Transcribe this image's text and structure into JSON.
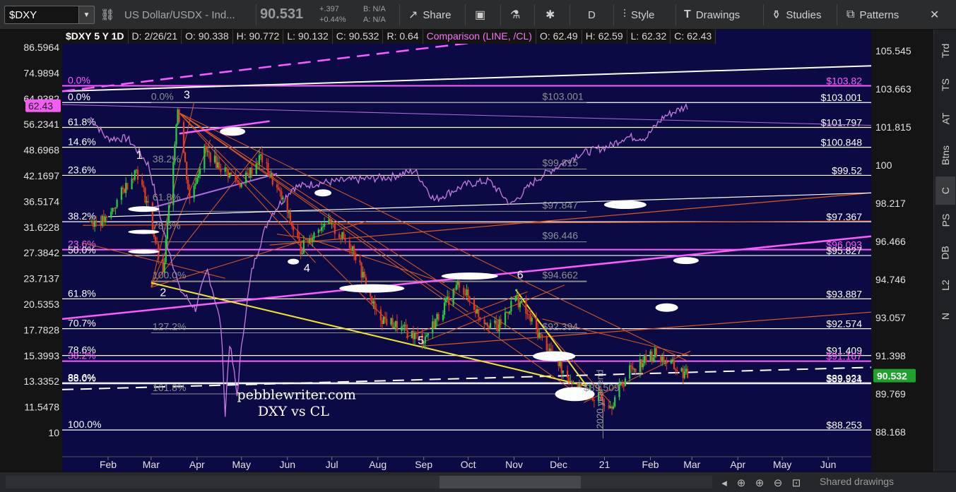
{
  "toolbar": {
    "symbol": "$DXY",
    "description": "US Dollar/USDX - Ind...",
    "price": "90.531",
    "change_abs": "+.397",
    "change_pct": "+0.44%",
    "bid": "B: N/A",
    "ask": "A: N/A",
    "share_label": "Share",
    "period_label": "D",
    "style_label": "Style",
    "drawings_label": "Drawings",
    "studies_label": "Studies",
    "patterns_label": "Patterns"
  },
  "header": {
    "symbol_period": "$DXY 5 Y 1D",
    "date": "D: 2/26/21",
    "open": "O: 90.338",
    "high": "H: 90.772",
    "low": "L: 90.132",
    "close": "C: 90.532",
    "range": "R: 0.64",
    "comparison": "Comparison (LINE, /CL)",
    "cmp_open": "O: 62.49",
    "cmp_high": "H: 62.59",
    "cmp_low": "L: 62.32",
    "cmp_close": "C: 62.43"
  },
  "side_tabs": [
    "Trd",
    "TS",
    "AT",
    "Btns",
    "C",
    "PS",
    "DB",
    "L2",
    "N"
  ],
  "bottom": {
    "shared_label": "Shared drawings"
  },
  "colors": {
    "plot_bg": "#0c0a45",
    "price_up": "#2ecc40",
    "price_down": "#e8391d",
    "comparison": "#c77be0",
    "fib_magenta": "#ff5cff",
    "trend_yellow": "#f1e22c",
    "fan_orange": "#e05a1c",
    "last_price_badge": "#1fa12d",
    "cmp_badge": "#f25cf2"
  },
  "chart_data": {
    "type": "candlestick",
    "x_axis_labels": [
      "Feb",
      "Mar",
      "Apr",
      "May",
      "Jun",
      "Jul",
      "Aug",
      "Sep",
      "Oct",
      "Nov",
      "Dec",
      "21",
      "Feb",
      "Mar",
      "Apr",
      "May",
      "Jun"
    ],
    "right_axis": {
      "ticks": [
        "105.545",
        "103.663",
        "101.815",
        "100",
        "98.217",
        "96.466",
        "94.746",
        "93.057",
        "91.398",
        "89.769",
        "88.168"
      ],
      "scale": "log",
      "range": [
        87.6,
        106.2
      ]
    },
    "left_axis": {
      "ticks": [
        "86.5964",
        "74.9894",
        "64.9382",
        "56.2341",
        "48.6968",
        "42.1697",
        "36.5174",
        "31.6228",
        "27.3842",
        "23.7137",
        "20.5353",
        "17.7828",
        "15.3993",
        "13.3352",
        "11.5478",
        "10"
      ],
      "scale": "log"
    },
    "last_price": "90.532",
    "comparison_last": "62.43",
    "price_series": [
      {
        "d": "2020-01-20",
        "v": 97.4
      },
      {
        "d": "2020-01-31",
        "v": 97.4
      },
      {
        "d": "2020-02-10",
        "v": 98.7
      },
      {
        "d": "2020-02-20",
        "v": 99.8
      },
      {
        "d": "2020-02-28",
        "v": 98.1
      },
      {
        "d": "2020-03-09",
        "v": 94.8
      },
      {
        "d": "2020-03-19",
        "v": 102.8
      },
      {
        "d": "2020-03-27",
        "v": 98.4
      },
      {
        "d": "2020-04-06",
        "v": 100.7
      },
      {
        "d": "2020-04-17",
        "v": 99.9
      },
      {
        "d": "2020-05-01",
        "v": 99.1
      },
      {
        "d": "2020-05-14",
        "v": 100.4
      },
      {
        "d": "2020-05-29",
        "v": 98.3
      },
      {
        "d": "2020-06-10",
        "v": 96.1
      },
      {
        "d": "2020-06-26",
        "v": 97.4
      },
      {
        "d": "2020-07-15",
        "v": 96.2
      },
      {
        "d": "2020-07-31",
        "v": 93.2
      },
      {
        "d": "2020-08-18",
        "v": 92.5
      },
      {
        "d": "2020-09-01",
        "v": 92.1
      },
      {
        "d": "2020-09-25",
        "v": 94.6
      },
      {
        "d": "2020-10-09",
        "v": 93.1
      },
      {
        "d": "2020-10-21",
        "v": 92.6
      },
      {
        "d": "2020-11-02",
        "v": 94.0
      },
      {
        "d": "2020-11-18",
        "v": 92.3
      },
      {
        "d": "2020-12-04",
        "v": 90.8
      },
      {
        "d": "2020-12-17",
        "v": 89.8
      },
      {
        "d": "2021-01-06",
        "v": 89.4
      },
      {
        "d": "2021-01-18",
        "v": 90.8
      },
      {
        "d": "2021-02-04",
        "v": 91.5
      },
      {
        "d": "2021-02-17",
        "v": 90.9
      },
      {
        "d": "2021-02-26",
        "v": 90.53
      }
    ],
    "comparison_series": [
      {
        "d": "2020-01-20",
        "v": 58.5
      },
      {
        "d": "2020-01-31",
        "v": 52.0
      },
      {
        "d": "2020-02-14",
        "v": 52.0
      },
      {
        "d": "2020-02-28",
        "v": 45.0
      },
      {
        "d": "2020-03-09",
        "v": 31.1
      },
      {
        "d": "2020-03-20",
        "v": 22.4
      },
      {
        "d": "2020-03-31",
        "v": 20.0
      },
      {
        "d": "2020-04-08",
        "v": 24.8
      },
      {
        "d": "2020-04-17",
        "v": 18.3
      },
      {
        "d": "2020-04-20",
        "v": 11.0
      },
      {
        "d": "2020-04-23",
        "v": 16.5
      },
      {
        "d": "2020-04-28",
        "v": 12.3
      },
      {
        "d": "2020-05-08",
        "v": 24.7
      },
      {
        "d": "2020-05-20",
        "v": 33.5
      },
      {
        "d": "2020-06-05",
        "v": 39.5
      },
      {
        "d": "2020-06-22",
        "v": 40.5
      },
      {
        "d": "2020-07-15",
        "v": 41.2
      },
      {
        "d": "2020-08-10",
        "v": 41.9
      },
      {
        "d": "2020-08-26",
        "v": 43.4
      },
      {
        "d": "2020-09-08",
        "v": 36.8
      },
      {
        "d": "2020-09-30",
        "v": 40.2
      },
      {
        "d": "2020-10-15",
        "v": 41.0
      },
      {
        "d": "2020-10-30",
        "v": 35.8
      },
      {
        "d": "2020-11-16",
        "v": 41.3
      },
      {
        "d": "2020-12-01",
        "v": 44.6
      },
      {
        "d": "2020-12-15",
        "v": 47.6
      },
      {
        "d": "2021-01-05",
        "v": 49.9
      },
      {
        "d": "2021-01-15",
        "v": 52.4
      },
      {
        "d": "2021-01-29",
        "v": 52.2
      },
      {
        "d": "2021-02-10",
        "v": 58.7
      },
      {
        "d": "2021-02-26",
        "v": 62.4
      }
    ],
    "price_levels": [
      {
        "value": 103.82,
        "label": "$103.82",
        "color": "#ff5cff",
        "dashed": false
      },
      {
        "value": 103.001,
        "label": "$103.001",
        "color": "#ffffff",
        "dashed": false
      },
      {
        "value": 101.797,
        "label": "$101.797",
        "color": "#ffffff",
        "dashed": false
      },
      {
        "value": 100.848,
        "label": "$100.848",
        "color": "#ffffff",
        "dashed": false
      },
      {
        "value": 99.52,
        "label": "$99.52",
        "color": "#ffffff",
        "dashed": false
      },
      {
        "value": 97.367,
        "label": "$97.367",
        "color": "#ffffff",
        "dashed": false
      },
      {
        "value": 96.093,
        "label": "$96.093",
        "color": "#ff5cff",
        "dashed": false
      },
      {
        "value": 95.827,
        "label": "$95.827",
        "color": "#ffffff",
        "dashed": false
      },
      {
        "value": 93.887,
        "label": "$93.887",
        "color": "#ffffff",
        "dashed": false
      },
      {
        "value": 92.574,
        "label": "$92.574",
        "color": "#ffffff",
        "dashed": false
      },
      {
        "value": 91.409,
        "label": "$91.409",
        "color": "#ffffff",
        "dashed": false
      },
      {
        "value": 91.167,
        "label": "$91.167",
        "color": "#ff5cff",
        "dashed": false
      },
      {
        "value": 90.24,
        "label": "$89.921",
        "color": "#ffffff",
        "dashed": false
      },
      {
        "value": 90.2,
        "label": "$89.934",
        "color": "#ffffff",
        "dashed": false
      },
      {
        "value": 88.253,
        "label": "$88.253",
        "color": "#ffffff",
        "dashed": false
      }
    ],
    "fib_ratio_labels": [
      {
        "label": "0.0%",
        "value": 103.82,
        "color": "#ff5cff"
      },
      {
        "label": "0.0%",
        "value": 103.001,
        "color": "#ffffff"
      },
      {
        "label": "61.8%",
        "value": 101.797,
        "color": "#ffffff"
      },
      {
        "label": "14.6%",
        "value": 100.848,
        "color": "#ffffff"
      },
      {
        "label": "23.6%",
        "value": 99.52,
        "color": "#ffffff"
      },
      {
        "label": "38.2%",
        "value": 97.367,
        "color": "#ffffff"
      },
      {
        "label": "23.6%",
        "value": 96.093,
        "color": "#ff5cff"
      },
      {
        "label": "50.0%",
        "value": 95.827,
        "color": "#ffffff"
      },
      {
        "label": "61.8%",
        "value": 93.887,
        "color": "#ffffff"
      },
      {
        "label": "70.7%",
        "value": 92.574,
        "color": "#ffffff"
      },
      {
        "label": "78.6%",
        "value": 91.409,
        "color": "#ffffff"
      },
      {
        "label": "38.2%",
        "value": 91.167,
        "color": "#ff5cff"
      },
      {
        "label": "88.6%",
        "value": 90.24,
        "color": "#ffffff"
      },
      {
        "label": "88.0%",
        "value": 90.2,
        "color": "#ffffff"
      },
      {
        "label": "100.0%",
        "value": 88.253,
        "color": "#ffffff"
      }
    ],
    "grey_fib_labels": [
      {
        "label": "0.0%",
        "d": "2020-03-01",
        "v": 103.0
      },
      {
        "label": "$103.001",
        "d": "2020-11-20",
        "v": 103.0
      },
      {
        "label": "38.2%",
        "d": "2020-03-02",
        "v": 100.0
      },
      {
        "label": "$99.815",
        "d": "2020-11-20",
        "v": 99.815
      },
      {
        "label": "61.8%",
        "d": "2020-03-02",
        "v": 98.217
      },
      {
        "label": "$97.847",
        "d": "2020-11-20",
        "v": 97.847
      },
      {
        "label": "78.6%",
        "d": "2020-03-02",
        "v": 96.9
      },
      {
        "label": "$96.446",
        "d": "2020-11-20",
        "v": 96.446
      },
      {
        "label": "100.0%",
        "d": "2020-03-02",
        "v": 94.662
      },
      {
        "label": "$94.662",
        "d": "2020-11-20",
        "v": 94.662
      },
      {
        "label": "127.2%",
        "d": "2020-03-02",
        "v": 92.394
      },
      {
        "label": "$92.394",
        "d": "2020-11-20",
        "v": 92.394
      },
      {
        "label": "161.8%",
        "d": "2020-03-02",
        "v": 89.769
      },
      {
        "label": "$89.509",
        "d": "2020-12-18",
        "v": 89.769
      }
    ],
    "wave_labels": [
      {
        "label": "1",
        "d": "2020-02-20",
        "v": 100.3
      },
      {
        "label": "3",
        "d": "2020-03-23",
        "v": 103.2
      },
      {
        "label": "2",
        "d": "2020-03-07",
        "v": 94.0
      },
      {
        "label": "4",
        "d": "2020-06-12",
        "v": 95.1
      },
      {
        "label": "5",
        "d": "2020-08-28",
        "v": 91.9
      },
      {
        "label": "6",
        "d": "2020-11-03",
        "v": 94.8
      }
    ],
    "annotations": [
      {
        "text": "pebblewriter.com",
        "d": "2020-04-28",
        "v": 89.55
      },
      {
        "text": "DXY vs CL",
        "d": "2020-05-12",
        "v": 88.85
      },
      {
        "text": "2020 year-end",
        "d": "2020-12-31",
        "v": 88.3
      }
    ]
  }
}
